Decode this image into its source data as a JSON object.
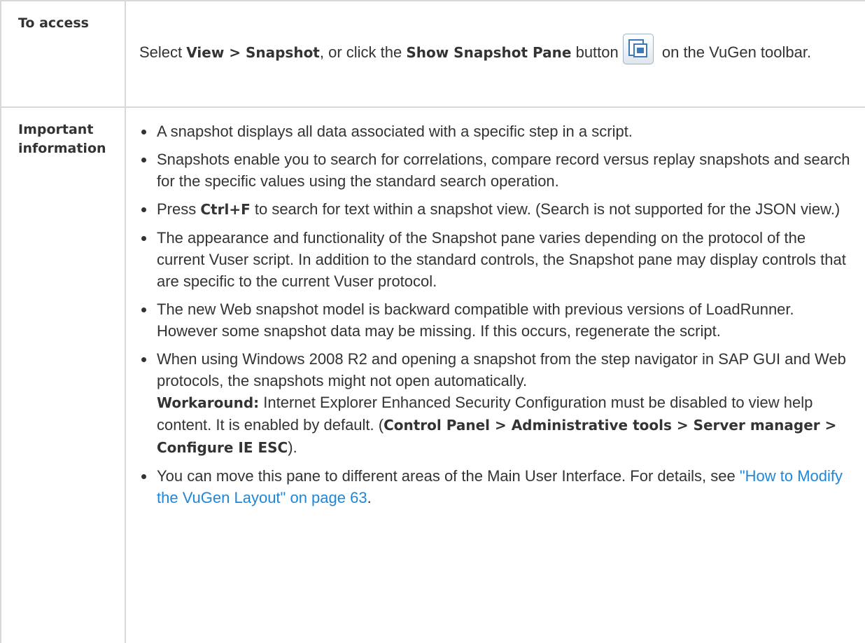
{
  "rows": {
    "access": {
      "label": "To access",
      "text_before": "Select ",
      "kw_view": "View > Snapshot",
      "text_mid": ", or click the ",
      "kw_button": "Show Snapshot Pane",
      "text_button": " button",
      "button_icon": "show-snapshot-pane-icon",
      "text_after": " on the VuGen toolbar."
    },
    "important": {
      "label_line1": "Important",
      "label_line2": "information",
      "items": [
        {
          "text": "A snapshot displays all data associated with a specific step in a script."
        },
        {
          "text": "Snapshots enable you to search for correlations, compare record versus replay snapshots and search for the specific values using the standard search operation."
        },
        {
          "pre": "Press ",
          "kw": "Ctrl+F",
          "post": " to search for text within a snapshot view. (Search is not supported for the JSON view.)"
        },
        {
          "text": "The appearance and functionality of the Snapshot pane varies depending on the protocol of the current Vuser script. In addition to the standard controls, the Snapshot pane may display controls that are specific to the current Vuser protocol."
        },
        {
          "text": "The new Web snapshot model is backward compatible with previous versions of LoadRunner. However some snapshot data may be missing. If this occurs, regenerate the script."
        },
        {
          "text": "When using Windows 2008 R2 and opening a snapshot from the step navigator in SAP GUI and Web protocols, the snapshots might not open automatically.",
          "kw_workaround": "Workaround:",
          "workaround_text": " Internet Explorer Enhanced Security Configuration must be disabled to view help content. It is enabled by default. (",
          "kw_path": "Control Panel > Administrative tools > Server manager > Configure IE ESC",
          "workaround_end": ")."
        },
        {
          "pre": "You can move this pane to different areas of the Main User Interface. For details, see ",
          "link": "\"How to Modify the VuGen Layout\" on page 63",
          "post": "."
        }
      ]
    }
  },
  "colors": {
    "border": "#d8d8d8",
    "text": "#333333",
    "link": "#1e87d8"
  }
}
